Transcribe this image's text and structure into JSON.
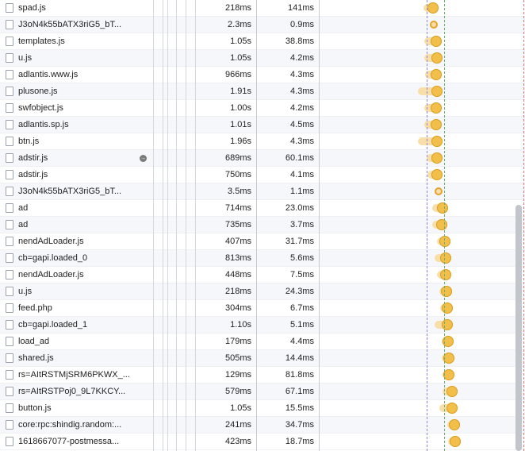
{
  "rows": [
    {
      "name": "spad.js",
      "duration": "218ms",
      "latency": "141ms",
      "icon": "js-file-icon",
      "bar": {
        "light_start": 0.504,
        "light_end": 0.524,
        "dark_start": 0.524,
        "dark_end": 0.536
      }
    },
    {
      "name": "J3oN4k55bATX3riG5_bT...",
      "duration": "2.3ms",
      "latency": "0.9ms",
      "icon": "js-file-icon",
      "bar": {
        "light_start": 0.5575,
        "light_end": 0.5575,
        "dark_start": 0.5575,
        "dark_end": 0.5575
      }
    },
    {
      "name": "templates.js",
      "duration": "1.05s",
      "latency": "38.8ms",
      "icon": "js-file-icon",
      "bar": {
        "light_start": 0.508,
        "light_end": 0.54,
        "dark_start": 0.54,
        "dark_end": 0.562
      }
    },
    {
      "name": "u.js",
      "duration": "1.05s",
      "latency": "4.2ms",
      "icon": "js-file-icon",
      "bar": {
        "light_start": 0.508,
        "light_end": 0.543,
        "dark_start": 0.543,
        "dark_end": 0.562
      }
    },
    {
      "name": "adlantis.www.js",
      "duration": "966ms",
      "latency": "4.3ms",
      "icon": "js-file-icon",
      "bar": {
        "light_start": 0.512,
        "light_end": 0.541,
        "dark_start": 0.541,
        "dark_end": 0.56
      }
    },
    {
      "name": "plusone.js",
      "duration": "1.91s",
      "latency": "4.3ms",
      "icon": "js-file-icon",
      "bar": {
        "light_start": 0.48,
        "light_end": 0.544,
        "dark_start": 0.544,
        "dark_end": 0.562
      }
    },
    {
      "name": "swfobject.js",
      "duration": "1.00s",
      "latency": "4.2ms",
      "icon": "js-file-icon",
      "bar": {
        "light_start": 0.51,
        "light_end": 0.541,
        "dark_start": 0.541,
        "dark_end": 0.558
      }
    },
    {
      "name": "adlantis.sp.js",
      "duration": "1.01s",
      "latency": "4.5ms",
      "icon": "js-file-icon",
      "bar": {
        "light_start": 0.51,
        "light_end": 0.541,
        "dark_start": 0.541,
        "dark_end": 0.558
      }
    },
    {
      "name": "btn.js",
      "duration": "1.96s",
      "latency": "4.3ms",
      "icon": "js-file-icon",
      "bar": {
        "light_start": 0.48,
        "light_end": 0.544,
        "dark_start": 0.544,
        "dark_end": 0.562
      }
    },
    {
      "name": "adstir.js",
      "duration": "689ms",
      "latency": "60.1ms",
      "icon": "js-file-icon",
      "goto_arrow": true,
      "bar": {
        "light_start": 0.522,
        "light_end": 0.544,
        "dark_start": 0.544,
        "dark_end": 0.564
      }
    },
    {
      "name": "adstir.js",
      "duration": "750ms",
      "latency": "4.1ms",
      "icon": "js-file-icon",
      "bar": {
        "light_start": 0.524,
        "light_end": 0.545,
        "dark_start": 0.545,
        "dark_end": 0.563
      }
    },
    {
      "name": "J3oN4k55bATX3riG5_bT...",
      "duration": "3.5ms",
      "latency": "1.1ms",
      "icon": "js-file-icon",
      "bar": {
        "light_start": 0.5775,
        "light_end": 0.5775,
        "dark_start": 0.5775,
        "dark_end": 0.5775
      }
    },
    {
      "name": "ad",
      "duration": "714ms",
      "latency": "23.0ms",
      "icon": "js-file-icon",
      "bar": {
        "light_start": 0.548,
        "light_end": 0.57,
        "dark_start": 0.57,
        "dark_end": 0.587
      }
    },
    {
      "name": "ad",
      "duration": "735ms",
      "latency": "3.7ms",
      "icon": "js-file-icon",
      "bar": {
        "light_start": 0.548,
        "light_end": 0.568,
        "dark_start": 0.568,
        "dark_end": 0.586
      }
    },
    {
      "name": "nendAdLoader.js",
      "duration": "407ms",
      "latency": "31.7ms",
      "icon": "js-file-icon",
      "bar": {
        "light_start": 0.572,
        "light_end": 0.584,
        "dark_start": 0.584,
        "dark_end": 0.599
      }
    },
    {
      "name": "cb=gapi.loaded_0",
      "duration": "813ms",
      "latency": "5.6ms",
      "icon": "js-file-icon",
      "bar": {
        "light_start": 0.56,
        "light_end": 0.585,
        "dark_start": 0.585,
        "dark_end": 0.601
      }
    },
    {
      "name": "nendAdLoader.js",
      "duration": "448ms",
      "latency": "7.5ms",
      "icon": "js-file-icon",
      "bar": {
        "light_start": 0.573,
        "light_end": 0.586,
        "dark_start": 0.586,
        "dark_end": 0.601
      }
    },
    {
      "name": "u.js",
      "duration": "218ms",
      "latency": "24.3ms",
      "icon": "js-file-icon",
      "bar": {
        "light_start": 0.582,
        "light_end": 0.589,
        "dark_start": 0.589,
        "dark_end": 0.603
      }
    },
    {
      "name": "feed.php",
      "duration": "304ms",
      "latency": "6.7ms",
      "icon": "php-file-icon",
      "bar": {
        "light_start": 0.586,
        "light_end": 0.594,
        "dark_start": 0.594,
        "dark_end": 0.606
      }
    },
    {
      "name": "cb=gapi.loaded_1",
      "duration": "1.10s",
      "latency": "5.1ms",
      "icon": "js-file-icon",
      "bar": {
        "light_start": 0.56,
        "light_end": 0.596,
        "dark_start": 0.596,
        "dark_end": 0.61
      }
    },
    {
      "name": "load_ad",
      "duration": "179ms",
      "latency": "4.4ms",
      "icon": "js-file-icon",
      "bar": {
        "light_start": 0.596,
        "light_end": 0.6,
        "dark_start": 0.6,
        "dark_end": 0.614
      }
    },
    {
      "name": "shared.js",
      "duration": "505ms",
      "latency": "14.4ms",
      "icon": "js-file-icon",
      "bar": {
        "light_start": 0.594,
        "light_end": 0.603,
        "dark_start": 0.603,
        "dark_end": 0.617
      }
    },
    {
      "name": "rs=AItRSTMjSRM6PKWX_...",
      "duration": "129ms",
      "latency": "81.8ms",
      "icon": "js-file-icon",
      "bar": {
        "light_start": 0.598,
        "light_end": 0.604,
        "dark_start": 0.604,
        "dark_end": 0.617
      }
    },
    {
      "name": "rs=AItRSTPoj0_9L7KKCY...",
      "duration": "579ms",
      "latency": "67.1ms",
      "icon": "js-file-icon",
      "bar": {
        "light_start": 0.598,
        "light_end": 0.616,
        "dark_start": 0.616,
        "dark_end": 0.632
      }
    },
    {
      "name": "button.js",
      "duration": "1.05s",
      "latency": "15.5ms",
      "icon": "js-file-icon",
      "bar": {
        "light_start": 0.584,
        "light_end": 0.617,
        "dark_start": 0.617,
        "dark_end": 0.632
      }
    },
    {
      "name": "core:rpc:shindig.random:...",
      "duration": "241ms",
      "latency": "34.7ms",
      "icon": "js-file-icon",
      "bar": {
        "light_start": 0.622,
        "light_end": 0.63,
        "dark_start": 0.63,
        "dark_end": 0.646
      }
    },
    {
      "name": "1618667077-postmessa...",
      "duration": "423ms",
      "latency": "18.7ms",
      "icon": "js-file-icon",
      "bar": {
        "light_start": 0.626,
        "light_end": 0.634,
        "dark_start": 0.634,
        "dark_end": 0.65
      }
    }
  ],
  "timeline_markers": {
    "dom_content_loaded": 0.521,
    "load": 0.607,
    "end": 0.656
  },
  "colors": {
    "bar_light": "#f8dfa9",
    "bar_dark": "#f2bf4b",
    "marker_blue": "#8c84e8",
    "marker_green": "#67b374",
    "marker_red": "#e07b7b"
  }
}
